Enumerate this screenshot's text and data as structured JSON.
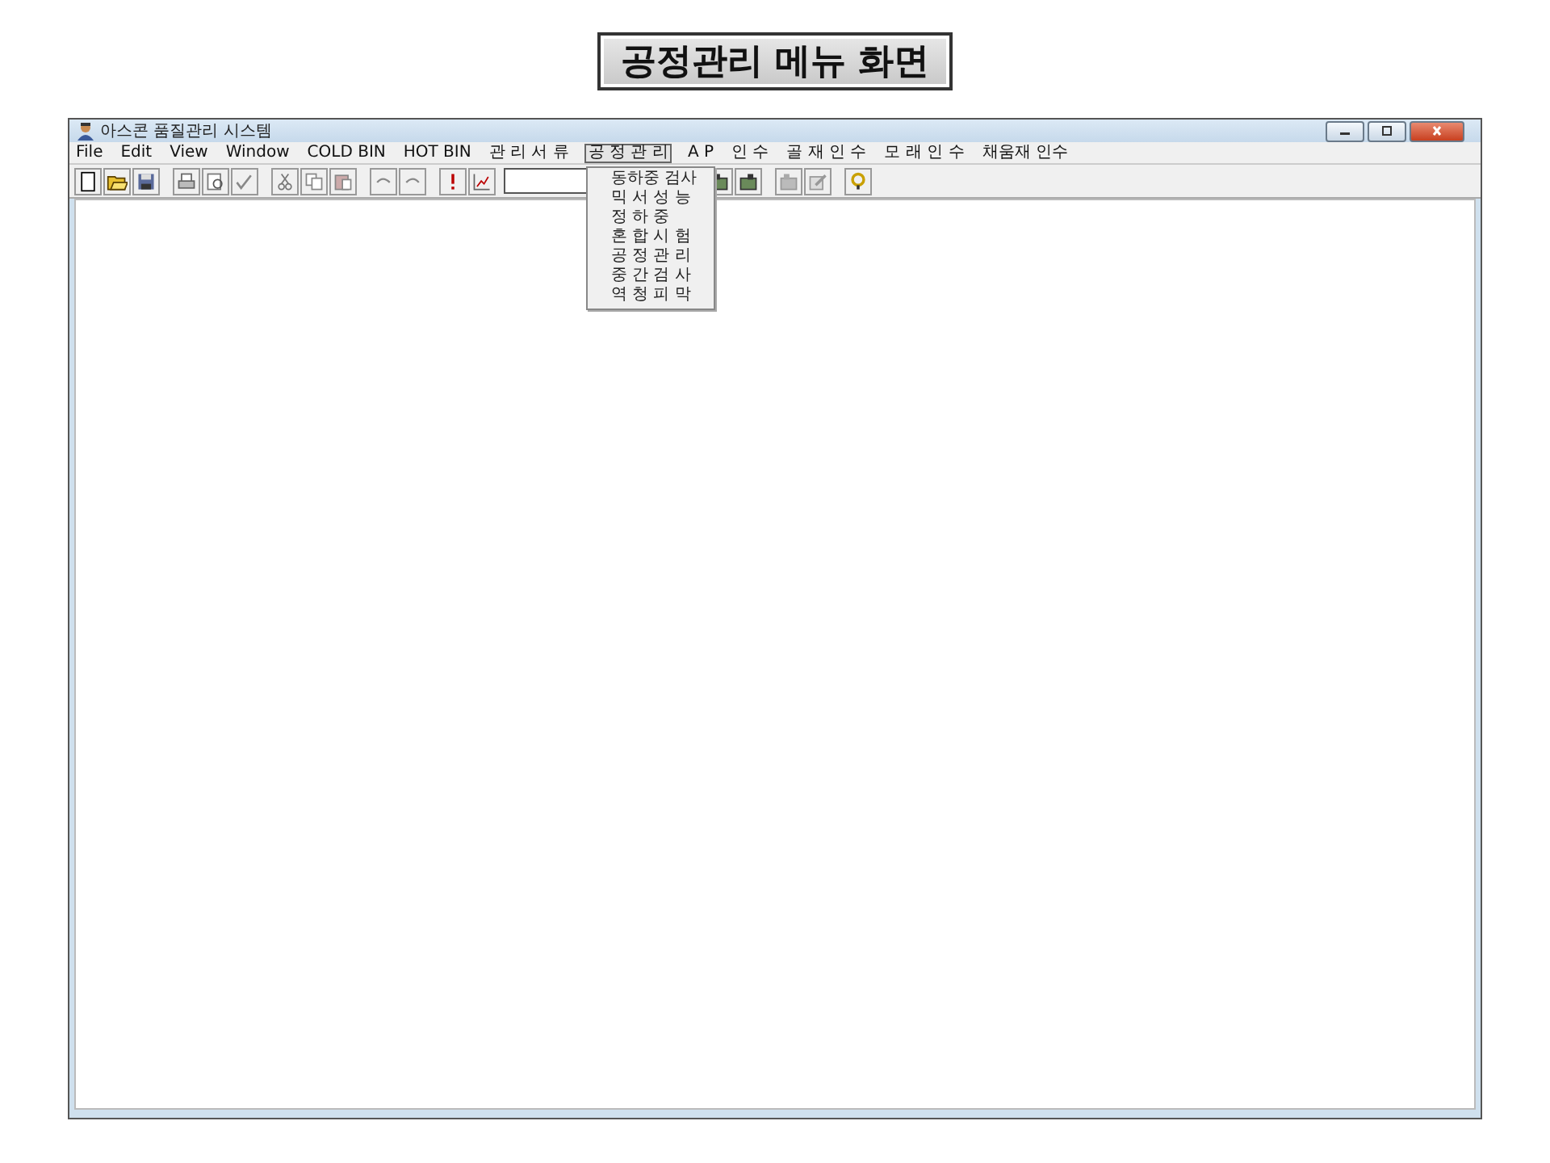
{
  "slide_title": "공정관리 메뉴 화면",
  "window": {
    "title": "아스콘 품질관리 시스템"
  },
  "menu": [
    {
      "label": "File",
      "selected": false
    },
    {
      "label": "Edit",
      "selected": false
    },
    {
      "label": "View",
      "selected": false
    },
    {
      "label": "Window",
      "selected": false
    },
    {
      "label": "COLD BIN",
      "selected": false
    },
    {
      "label": "HOT BIN",
      "selected": false
    },
    {
      "label": "관 리 서 류",
      "selected": false
    },
    {
      "label": "공 정 관 리",
      "selected": true
    },
    {
      "label": "A P",
      "selected": false
    },
    {
      "label": "인 수",
      "selected": false
    },
    {
      "label": "골 재 인 수",
      "selected": false
    },
    {
      "label": "모 래 인 수",
      "selected": false
    },
    {
      "label": "채움재 인수",
      "selected": false
    }
  ],
  "dropdown": [
    "동하중 검사",
    "믹 서 성 능",
    "정 하 중",
    "혼 합 시 험",
    "공 정 관 리",
    "중 간 검 사",
    "역 청 피 막"
  ]
}
